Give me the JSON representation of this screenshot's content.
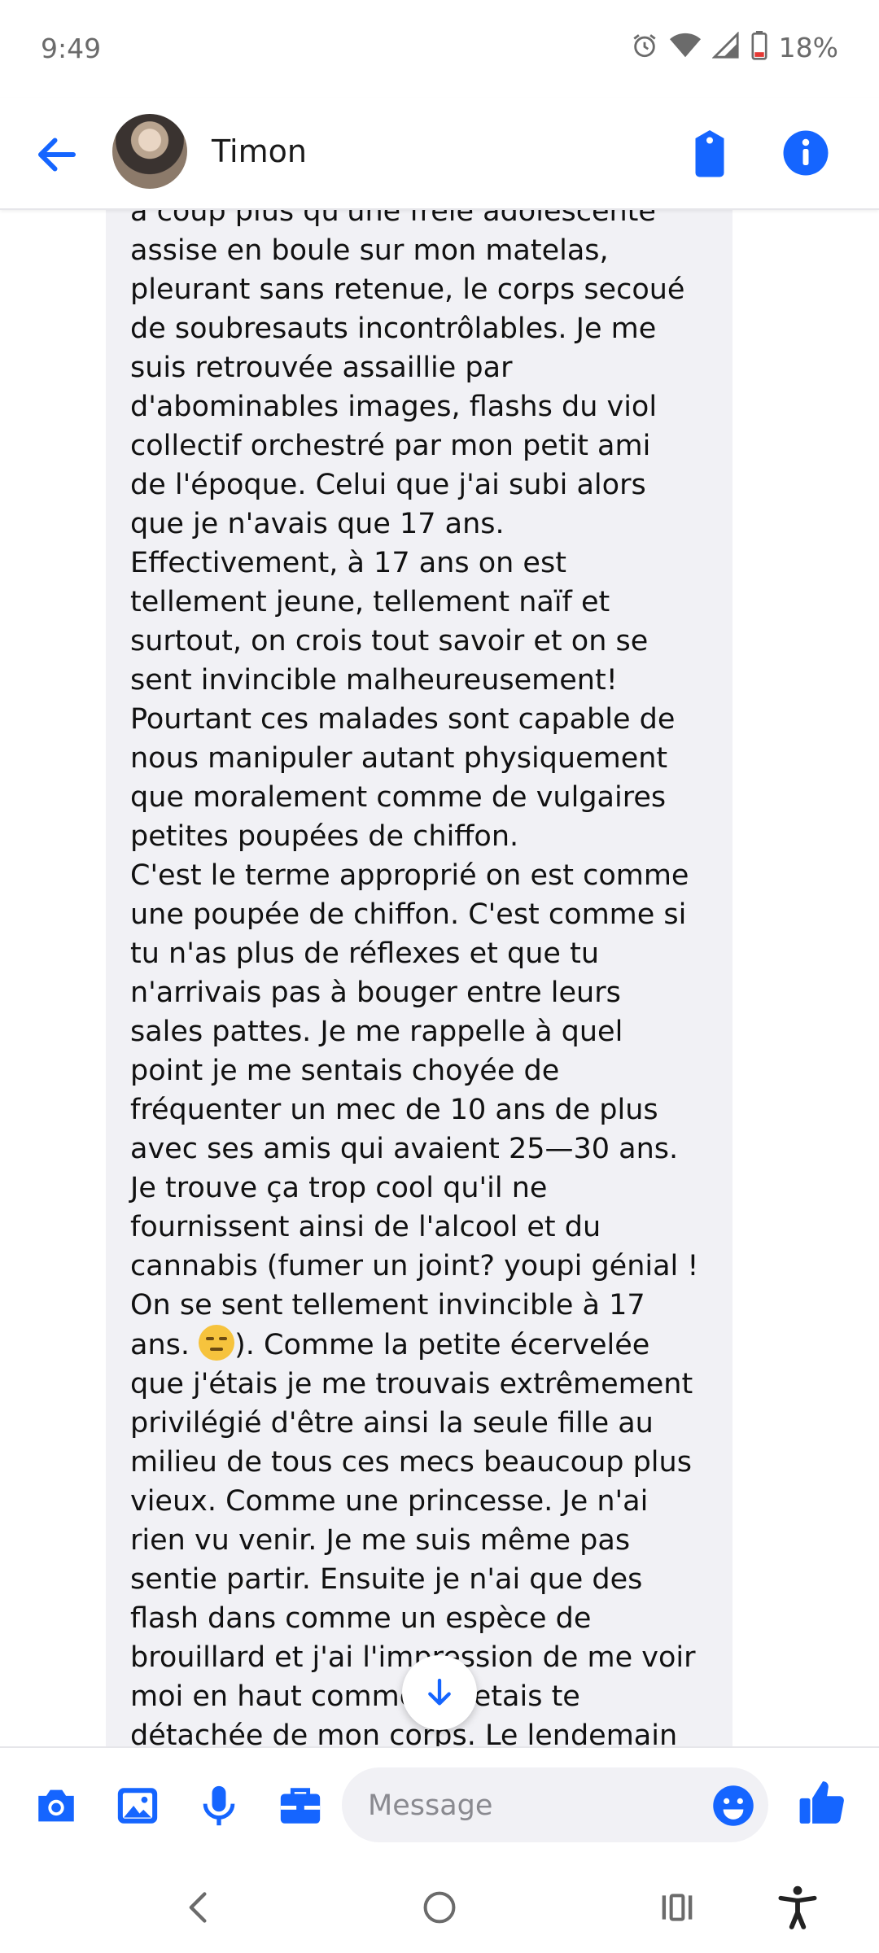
{
  "status_bar": {
    "time": "9:49",
    "battery_text": "18%",
    "icons": [
      "alarm-icon",
      "wifi-icon",
      "signal-icon",
      "battery-icon"
    ]
  },
  "header": {
    "contact_name": "Timon",
    "icons": [
      "back-arrow-icon",
      "avatar",
      "call-icon",
      "info-icon"
    ],
    "accent_color": "#1565ff"
  },
  "message": {
    "text_before_emoji": "à coup plus qu'une frêle adolescente\nassise en boule sur mon matelas,\npleurant sans retenue, le corps secoué\nde soubresauts incontrôlables. Je me\nsuis retrouvée assaillie par\nd'abominables images, flashs du viol\ncollectif orchestré par mon petit ami\nde l'époque. Celui que j'ai subi alors\nque je n'avais que 17 ans.\nEffectivement, à 17 ans on est\ntellement jeune, tellement naïf et\nsurtout, on crois tout savoir et on se\nsent invincible malheureusement!\nPourtant ces malades sont capable de\nnous manipuler autant physiquement\nque moralement comme de vulgaires\npetites poupées de chiffon.\nC'est le terme approprié on est comme\nune poupée de chiffon.  C'est comme si\ntu n'as plus de réflexes et que tu\nn'arrivais pas à bouger entre leurs\nsales pattes. Je me rappelle à quel\npoint je me sentais choyée de\nfréquenter un mec de 10 ans de plus\navec ses amis qui avaient 25—30 ans.\nJe trouve ça trop cool qu'il ne\nfournissent ainsi de l'alcool et du\ncannabis (fumer un joint? youpi génial !\nOn se sent tellement invincible à 17\nans. ",
    "emoji": "expressionless-face-emoji",
    "text_after_emoji": "). Comme la petite écervelée\nque j'étais je me trouvais extrêmement\nprivilégié d'être ainsi la seule fille au\nmilieu de tous ces mecs beaucoup plus\nvieux. Comme une princesse. Je n'ai\nrien vu venir. Je me suis même pas\nsentie partir. Ensuite je n'ai que des\nflash dans comme un espèce de\nbrouillard et j'ai l'impression de me voir\nmoi en haut comme si j'etais te\ndétachée de mon corps. Le lendemain"
  },
  "composer": {
    "placeholder": "Message",
    "icons": [
      "camera-icon",
      "gallery-icon",
      "microphone-icon",
      "briefcase-icon",
      "emoji-icon",
      "thumbs-up-icon"
    ]
  },
  "navbar": {
    "icons": [
      "back-nav-icon",
      "home-nav-icon",
      "recents-nav-icon",
      "accessibility-icon"
    ]
  }
}
